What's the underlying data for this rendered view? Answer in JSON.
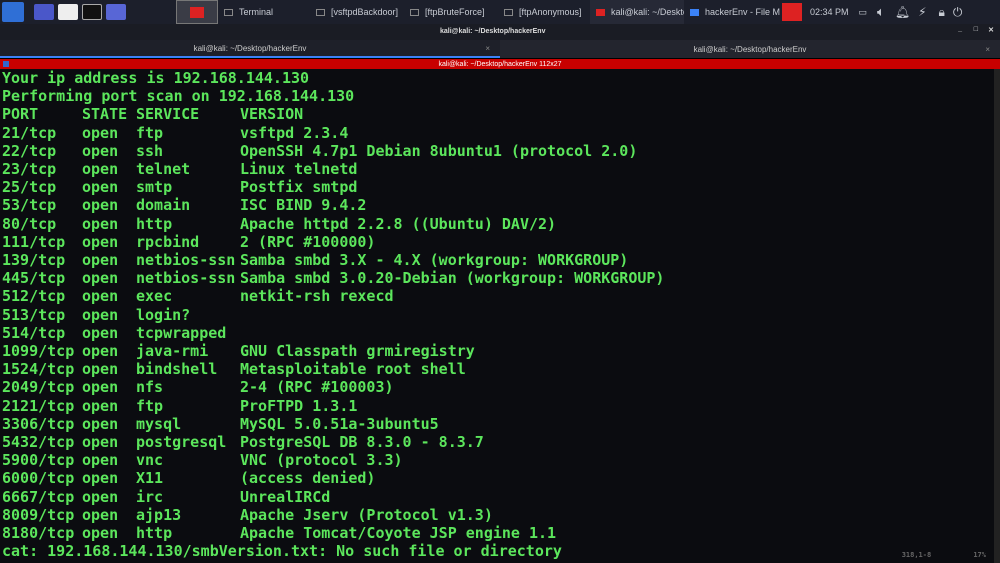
{
  "taskbar": {
    "tasks": [
      "Terminal",
      "[vsftpdBackdoor]",
      "[ftpBruteForce]",
      "[ftpAnonymous]",
      "kali@kali: ~/Desktop/...",
      "hackerEnv - File Man..."
    ],
    "clock": "02:34 PM"
  },
  "window": {
    "title": "kali@kali: ~/Desktop/hackerEnv"
  },
  "tabs": [
    {
      "label": "kali@kali: ~/Desktop/hackerEnv"
    },
    {
      "label": "kali@kali: ~/Desktop/hackerEnv"
    }
  ],
  "pane_title": "kali@kali: ~/Desktop/hackerEnv 112x27",
  "terminal": {
    "intro": [
      "Your ip address is 192.168.144.130",
      "Performing port scan on 192.168.144.130"
    ],
    "header": {
      "port": "PORT",
      "state": "STATE",
      "service": "SERVICE",
      "version": "VERSION"
    },
    "rows": [
      [
        "21/tcp",
        "open",
        "ftp",
        "vsftpd 2.3.4"
      ],
      [
        "22/tcp",
        "open",
        "ssh",
        "OpenSSH 4.7p1 Debian 8ubuntu1 (protocol 2.0)"
      ],
      [
        "23/tcp",
        "open",
        "telnet",
        "Linux telnetd"
      ],
      [
        "25/tcp",
        "open",
        "smtp",
        "Postfix smtpd"
      ],
      [
        "53/tcp",
        "open",
        "domain",
        "ISC BIND 9.4.2"
      ],
      [
        "80/tcp",
        "open",
        "http",
        "Apache httpd 2.2.8 ((Ubuntu) DAV/2)"
      ],
      [
        "111/tcp",
        "open",
        "rpcbind",
        "2 (RPC #100000)"
      ],
      [
        "139/tcp",
        "open",
        "netbios-ssn",
        "Samba smbd 3.X - 4.X (workgroup: WORKGROUP)"
      ],
      [
        "445/tcp",
        "open",
        "netbios-ssn",
        "Samba smbd 3.0.20-Debian (workgroup: WORKGROUP)"
      ],
      [
        "512/tcp",
        "open",
        "exec",
        "netkit-rsh rexecd"
      ],
      [
        "513/tcp",
        "open",
        "login?",
        ""
      ],
      [
        "514/tcp",
        "open",
        "tcpwrapped",
        ""
      ],
      [
        "1099/tcp",
        "open",
        "java-rmi",
        "GNU Classpath grmiregistry"
      ],
      [
        "1524/tcp",
        "open",
        "bindshell",
        "Metasploitable root shell"
      ],
      [
        "2049/tcp",
        "open",
        "nfs",
        "2-4 (RPC #100003)"
      ],
      [
        "2121/tcp",
        "open",
        "ftp",
        "ProFTPD 1.3.1"
      ],
      [
        "3306/tcp",
        "open",
        "mysql",
        "MySQL 5.0.51a-3ubuntu5"
      ],
      [
        "5432/tcp",
        "open",
        "postgresql",
        "PostgreSQL DB 8.3.0 - 8.3.7"
      ],
      [
        "5900/tcp",
        "open",
        "vnc",
        "VNC (protocol 3.3)"
      ],
      [
        "6000/tcp",
        "open",
        "X11",
        "(access denied)"
      ],
      [
        "6667/tcp",
        "open",
        "irc",
        "UnrealIRCd"
      ],
      [
        "8009/tcp",
        "open",
        "ajp13",
        "Apache Jserv (Protocol v1.3)"
      ],
      [
        "8180/tcp",
        "open",
        "http",
        "Apache Tomcat/Coyote JSP engine 1.1"
      ]
    ],
    "error": "cat: 192.168.144.130/smbVersion.txt: No such file or directory",
    "status": "318,1-8          17%"
  }
}
